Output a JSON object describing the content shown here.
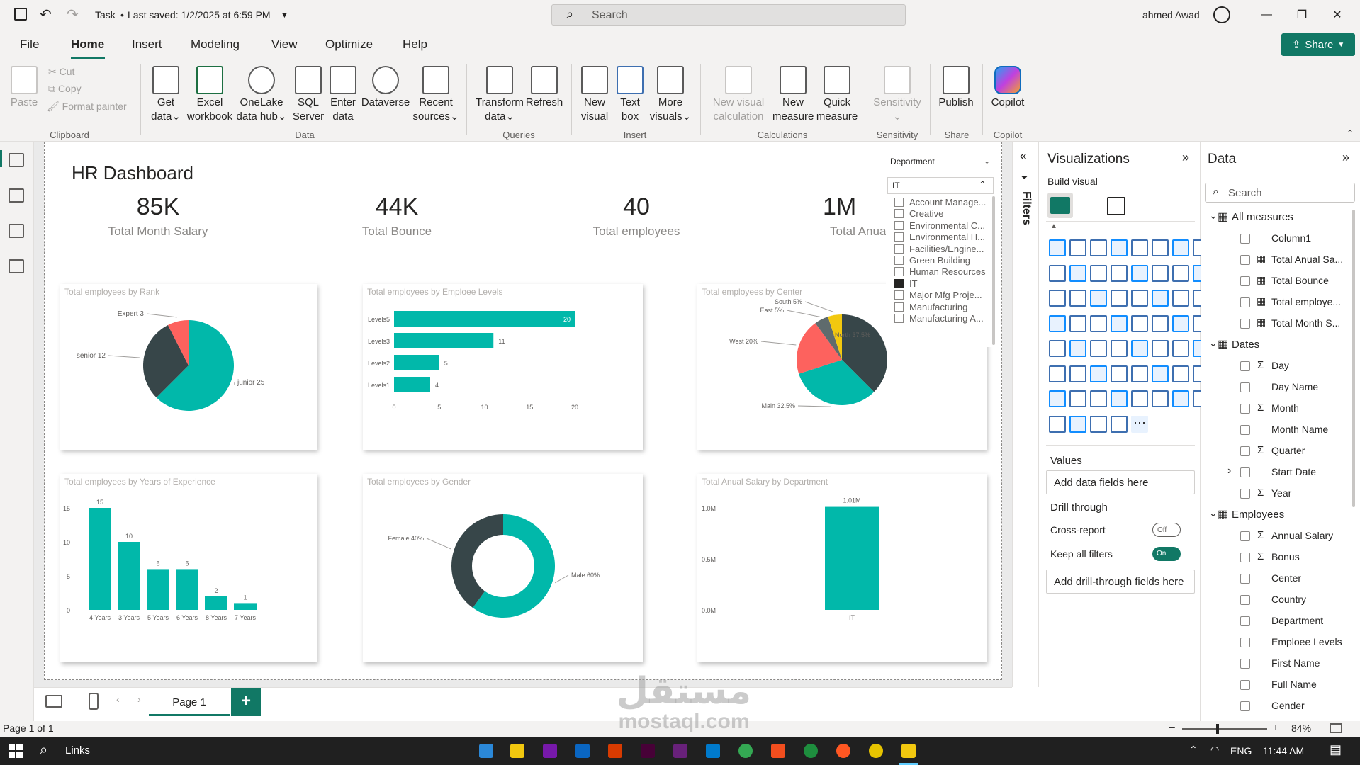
{
  "title_bar": {
    "doc_title": "Task",
    "last_saved": "Last saved: 1/2/2025 at 6:59 PM",
    "search_placeholder": "Search",
    "user_name": "ahmed Awad"
  },
  "menu": {
    "items": [
      "File",
      "Home",
      "Insert",
      "Modeling",
      "View",
      "Optimize",
      "Help"
    ],
    "active": "Home",
    "share_label": "Share"
  },
  "ribbon": {
    "clipboard": {
      "paste": "Paste",
      "cut": "Cut",
      "copy": "Copy",
      "format_painter": "Format painter",
      "group": "Clipboard"
    },
    "data": {
      "get_data": [
        "Get",
        "data"
      ],
      "excel": [
        "Excel",
        "workbook"
      ],
      "onelake": [
        "OneLake",
        "data hub"
      ],
      "sql": [
        "SQL",
        "Server"
      ],
      "enter": [
        "Enter",
        "data"
      ],
      "dataverse": [
        "Dataverse"
      ],
      "recent": [
        "Recent",
        "sources"
      ],
      "group": "Data"
    },
    "queries": {
      "transform": [
        "Transform",
        "data"
      ],
      "refresh": [
        "Refresh"
      ],
      "group": "Queries"
    },
    "insert": {
      "new_visual": [
        "New",
        "visual"
      ],
      "text_box": [
        "Text",
        "box"
      ],
      "more_visuals": [
        "More",
        "visuals"
      ],
      "group": "Insert"
    },
    "calculations": {
      "new_visual_calc": [
        "New visual",
        "calculation"
      ],
      "new_measure": [
        "New",
        "measure"
      ],
      "quick_measure": [
        "Quick",
        "measure"
      ],
      "group": "Calculations"
    },
    "sensitivity": {
      "label": "Sensitivity",
      "group": "Sensitivity"
    },
    "share": {
      "publish": "Publish",
      "group": "Share"
    },
    "copilot": {
      "label": "Copilot",
      "group": "Copilot"
    }
  },
  "report": {
    "title": "HR Dashboard",
    "kpis": [
      {
        "value": "85K",
        "label": "Total Month Salary"
      },
      {
        "value": "44K",
        "label": "Total Bounce"
      },
      {
        "value": "40",
        "label": "Total employees"
      },
      {
        "value": "1M",
        "label": "Total Anual"
      }
    ],
    "slicer": {
      "title": "Department",
      "selected": "IT",
      "items": [
        {
          "label": "Account Manage...",
          "checked": false
        },
        {
          "label": "Creative",
          "checked": false
        },
        {
          "label": "Environmental C...",
          "checked": false
        },
        {
          "label": "Environmental H...",
          "checked": false
        },
        {
          "label": "Facilities/Engine...",
          "checked": false
        },
        {
          "label": "Green Building",
          "checked": false
        },
        {
          "label": "Human Resources",
          "checked": false
        },
        {
          "label": "IT",
          "checked": true
        },
        {
          "label": "Major Mfg Proje...",
          "checked": false
        },
        {
          "label": "Manufacturing",
          "checked": false
        },
        {
          "label": "Manufacturing A...",
          "checked": false
        }
      ]
    },
    "colors": {
      "teal": "#01B8AA",
      "dark": "#374649",
      "red": "#FD625E",
      "yellow": "#F2C80F",
      "gray": "#5F6B6D"
    }
  },
  "chart_data": [
    {
      "type": "pie",
      "title": "Total employees by Rank",
      "categories": [
        "junior",
        "senior",
        "Expert"
      ],
      "values": [
        25,
        12,
        3
      ],
      "labels": [
        "junior 25",
        "senior 12",
        "Expert 3"
      ]
    },
    {
      "type": "bar",
      "orientation": "horizontal",
      "title": "Total employees by Emploee Levels",
      "categories": [
        "Levels5",
        "Levels3",
        "Levels2",
        "Levels1"
      ],
      "values": [
        20,
        11,
        5,
        4
      ],
      "xlim": [
        0,
        20
      ],
      "xticks": [
        "0",
        "5",
        "10",
        "15",
        "20"
      ]
    },
    {
      "type": "pie",
      "title": "Total employees by Center",
      "categories": [
        "North",
        "Main",
        "West",
        "East",
        "South"
      ],
      "values": [
        37.5,
        32.5,
        20,
        5,
        5
      ],
      "labels": [
        "North 37.5%",
        "Main 32.5%",
        "West 20%",
        "East 5%",
        "South 5%"
      ]
    },
    {
      "type": "bar",
      "title": "Total employees by Years of Experience",
      "categories": [
        "4 Years",
        "3 Years",
        "5 Years",
        "6 Years",
        "8 Years",
        "7 Years"
      ],
      "values": [
        15,
        10,
        6,
        6,
        2,
        1
      ],
      "ylim": [
        0,
        15
      ],
      "yticks": [
        "0",
        "5",
        "10",
        "15"
      ]
    },
    {
      "type": "pie",
      "subtype": "donut",
      "title": "Total employees by Gender",
      "categories": [
        "Male",
        "Female"
      ],
      "values": [
        60,
        40
      ],
      "labels": [
        "Male 60%",
        "Female 40%"
      ]
    },
    {
      "type": "bar",
      "title": "Total Anual Salary by Department",
      "categories": [
        "IT"
      ],
      "values": [
        1.01
      ],
      "data_labels": [
        "1.01M"
      ],
      "ylim": [
        0,
        1.0
      ],
      "yticks": [
        "0.0M",
        "0.5M",
        "1.0M"
      ]
    }
  ],
  "filters_label": "Filters",
  "visualizations": {
    "title": "Visualizations",
    "build_visual": "Build visual",
    "values_label": "Values",
    "values_placeholder": "Add data fields here",
    "drill_through": "Drill through",
    "cross_report": "Cross-report",
    "cross_report_state": "Off",
    "keep_filters": "Keep all filters",
    "keep_filters_state": "On",
    "drill_placeholder": "Add drill-through fields here"
  },
  "data_pane": {
    "title": "Data",
    "search_placeholder": "Search",
    "tables": [
      {
        "name": "All measures",
        "fields": [
          "Column1",
          "Total Anual Sa...",
          "Total Bounce",
          "Total employe...",
          "Total Month S..."
        ]
      },
      {
        "name": "Dates",
        "fields": [
          "Day",
          "Day Name",
          "Month",
          "Month Name",
          "Quarter",
          "Start Date",
          "Year"
        ]
      },
      {
        "name": "Employees",
        "fields": [
          "Annual Salary",
          "Bonus",
          "Center",
          "Country",
          "Department",
          "Emploee Levels",
          "First Name",
          "Full Name",
          "Gender"
        ]
      }
    ]
  },
  "pages": {
    "tab": "Page 1",
    "add": "+"
  },
  "status": {
    "page": "Page 1 of 1",
    "zoom": "84%"
  },
  "taskbar": {
    "search": "Links",
    "lang": "ENG",
    "time": "11:44 AM"
  },
  "watermark": {
    "arabic": "مستقل",
    "latin": "mostaql.com"
  }
}
